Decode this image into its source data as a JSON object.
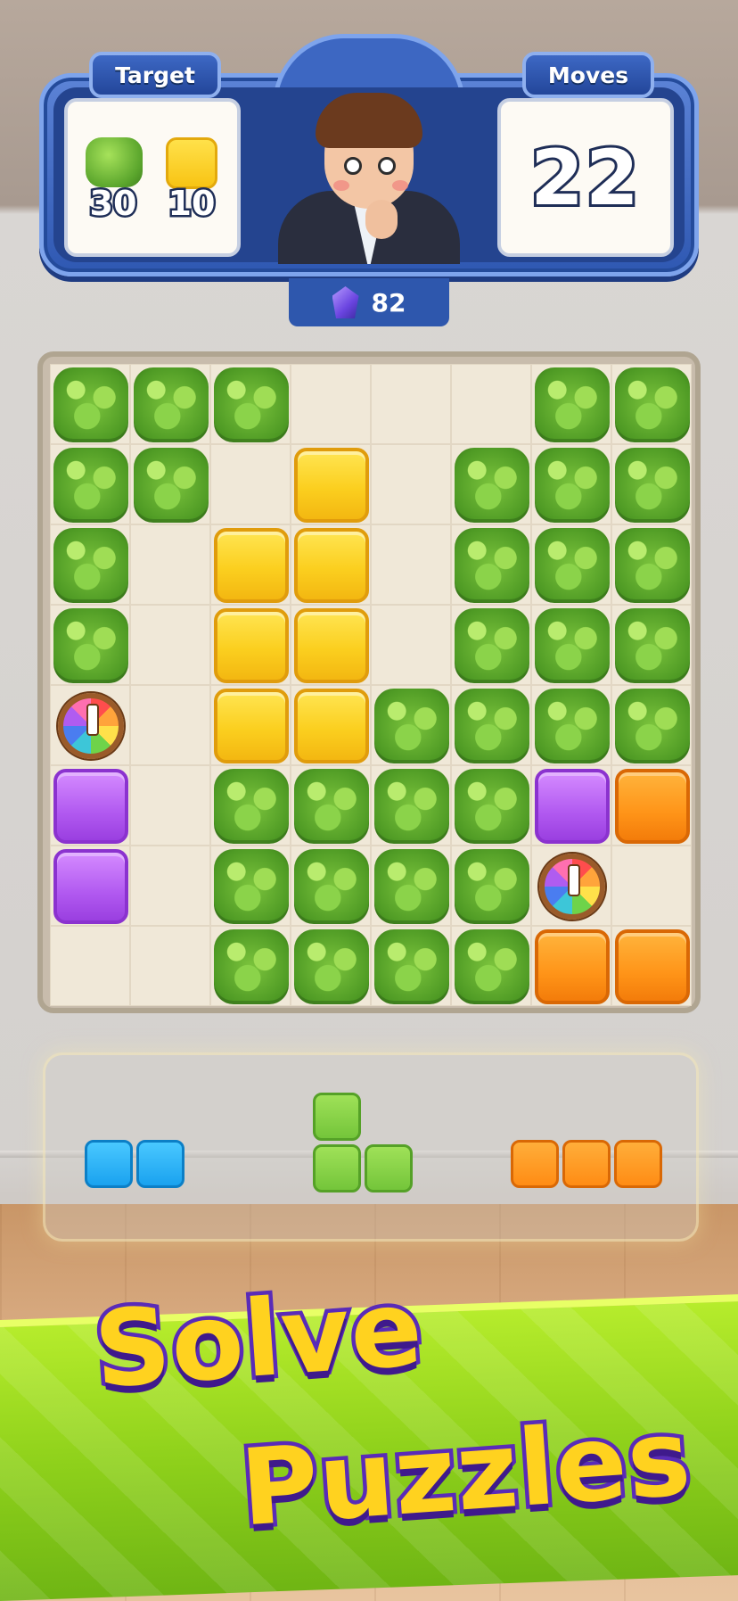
{
  "hud": {
    "target_label": "Target",
    "moves_label": "Moves",
    "moves_value": "22",
    "gems_count": "82",
    "goals": [
      {
        "type": "leaf",
        "icon": "leaf-block-icon",
        "count": "30"
      },
      {
        "type": "yellow",
        "icon": "yellow-block-icon",
        "count": "10"
      }
    ]
  },
  "board": {
    "rows": [
      [
        "L",
        "L",
        "L",
        "E",
        "E",
        "E",
        "L",
        "L"
      ],
      [
        "L",
        "L",
        "E",
        "Y",
        "E",
        "L",
        "L",
        "L"
      ],
      [
        "L",
        "E",
        "Y",
        "Y",
        "E",
        "L",
        "L",
        "L"
      ],
      [
        "L",
        "E",
        "Y",
        "Y",
        "E",
        "L",
        "L",
        "L"
      ],
      [
        "W",
        "E",
        "Y",
        "Y",
        "L",
        "L",
        "L",
        "L"
      ],
      [
        "P",
        "E",
        "L",
        "L",
        "L",
        "L",
        "P",
        "O"
      ],
      [
        "P",
        "E",
        "L",
        "L",
        "L",
        "L",
        "W",
        "E"
      ],
      [
        "E",
        "E",
        "L",
        "L",
        "L",
        "L",
        "O",
        "O"
      ]
    ],
    "legend": {
      "L": "leaf",
      "Y": "yellow",
      "P": "purple",
      "O": "orange",
      "W": "wheel",
      "E": "empty"
    }
  },
  "tray": {
    "pieces": [
      {
        "name": "blue-domino",
        "color": "blue",
        "cells": [
          [
            0,
            0
          ],
          [
            0,
            1
          ]
        ]
      },
      {
        "name": "green-l-tromino",
        "color": "green",
        "cells": [
          [
            0,
            0
          ],
          [
            1,
            0
          ],
          [
            1,
            1
          ]
        ]
      },
      {
        "name": "orange-tromino",
        "color": "orange",
        "cells": [
          [
            0,
            0
          ],
          [
            0,
            1
          ],
          [
            0,
            2
          ]
        ]
      }
    ]
  },
  "banner": {
    "line1": "Solve",
    "line2": "Puzzles"
  },
  "colors": {
    "hud_blue": "#2f58b2",
    "leaf_green": "#7cc43d",
    "yellow": "#fbcf1f",
    "purple": "#b159f0",
    "orange": "#ff9418",
    "blue": "#1aa2ef",
    "slogan_yellow": "#ffd21f",
    "slogan_outline": "#5a2bb8"
  }
}
